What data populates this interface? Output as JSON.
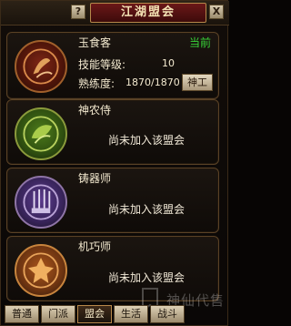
{
  "window": {
    "title": "江湖盟会",
    "help_label": "?",
    "close_label": "X"
  },
  "panels": [
    {
      "name": "玉食客",
      "status": "当前",
      "level_label": "技能等级:",
      "level_value": "10",
      "proficiency_label": "熟练度:",
      "proficiency_value": "1870/1870",
      "rank_button": "神工"
    },
    {
      "name": "神农侍",
      "join_status": "尚未加入该盟会"
    },
    {
      "name": "铸器师",
      "join_status": "尚未加入该盟会"
    },
    {
      "name": "机巧师",
      "join_status": "尚未加入该盟会"
    }
  ],
  "tabs": [
    "普通",
    "门派",
    "盟会",
    "生活",
    "战斗"
  ],
  "active_tab": "盟会",
  "watermark": "神仙代售",
  "colors": {
    "current_status": "#38d338",
    "title_plate": "#6b1818"
  }
}
